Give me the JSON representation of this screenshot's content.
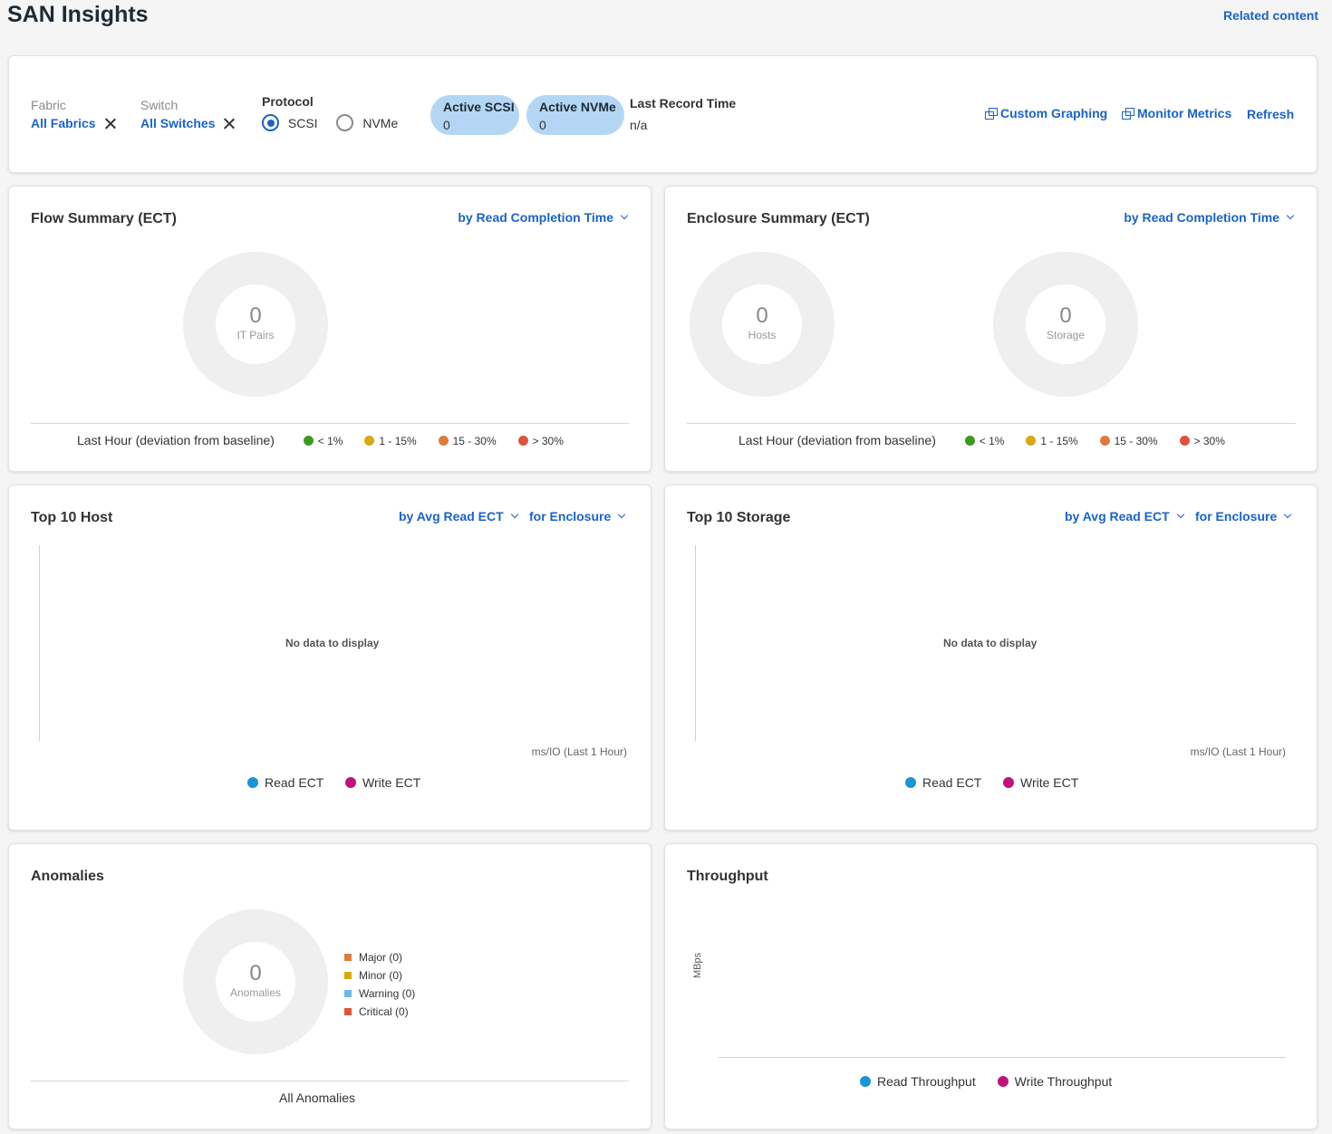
{
  "page": {
    "title": "SAN Insights",
    "related_link": "Related content"
  },
  "filters": {
    "fabric": {
      "label": "Fabric",
      "value": "All Fabrics"
    },
    "switch": {
      "label": "Switch",
      "value": "All Switches"
    },
    "protocol": {
      "label": "Protocol",
      "options": [
        "SCSI",
        "NVMe"
      ],
      "selected": "SCSI"
    },
    "active_scsi": {
      "label": "Active SCSI",
      "value": "0"
    },
    "active_nvme": {
      "label": "Active NVMe",
      "value": "0"
    },
    "last_record": {
      "label": "Last Record Time",
      "value": "n/a"
    },
    "actions": {
      "custom_graphing": "Custom Graphing",
      "monitor_metrics": "Monitor Metrics",
      "refresh": "Refresh"
    }
  },
  "legend_ranges": [
    "< 1%",
    "1 - 15%",
    "15 - 30%",
    "> 30%"
  ],
  "legend_colors": [
    "#3c9a1e",
    "#d8a90f",
    "#e07b3c",
    "#e0533c"
  ],
  "flow_summary": {
    "title": "Flow Summary (ECT)",
    "sort": "by Read Completion Time",
    "donut": {
      "value": "0",
      "label": "IT Pairs"
    },
    "footer": "Last Hour (deviation from baseline)"
  },
  "enclosure_summary": {
    "title": "Enclosure Summary (ECT)",
    "sort": "by Read Completion Time",
    "hosts": {
      "value": "0",
      "label": "Hosts"
    },
    "storage": {
      "value": "0",
      "label": "Storage"
    },
    "footer": "Last Hour (deviation from baseline)"
  },
  "top_host": {
    "title": "Top 10 Host",
    "sort": "by Avg Read ECT",
    "scope": "for Enclosure",
    "empty": "No data to display",
    "units": "ms/IO (Last 1 Hour)",
    "legend": [
      "Read ECT",
      "Write ECT"
    ]
  },
  "top_storage": {
    "title": "Top 10 Storage",
    "sort": "by Avg Read ECT",
    "scope": "for Enclosure",
    "empty": "No data to display",
    "units": "ms/IO (Last 1 Hour)",
    "legend": [
      "Read ECT",
      "Write ECT"
    ]
  },
  "series_colors": {
    "read": "#1796d6",
    "write": "#c0127a"
  },
  "anomalies": {
    "title": "Anomalies",
    "donut": {
      "value": "0",
      "label": "Anomalies"
    },
    "legend": [
      "Major (0)",
      "Minor (0)",
      "Warning (0)",
      "Critical (0)"
    ],
    "legend_colors": [
      "#e07b3c",
      "#d8a90f",
      "#6cb8e6",
      "#e0533c"
    ],
    "footer": "All Anomalies"
  },
  "throughput": {
    "title": "Throughput",
    "ylabel": "MBps",
    "legend": [
      "Read Throughput",
      "Write Throughput"
    ]
  }
}
